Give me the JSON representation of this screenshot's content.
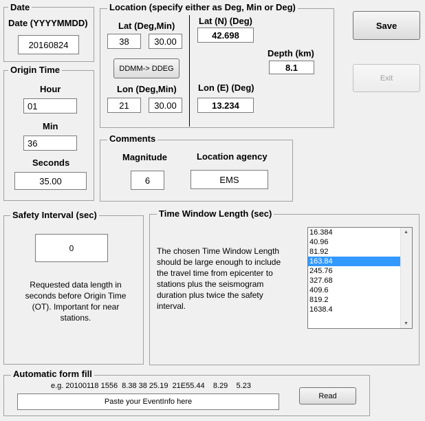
{
  "date_group": {
    "legend": "Date",
    "label": "Date  (YYYYMMDD)",
    "value": "20160824"
  },
  "origin_time": {
    "legend": "Origin Time",
    "hour_label": "Hour",
    "hour_value": "01",
    "min_label": "Min",
    "min_value": "36",
    "seconds_label": "Seconds",
    "seconds_value": "35.00"
  },
  "location": {
    "legend": "Location (specify either as Deg, Min or Deg)",
    "lat_dm_label": "Lat (Deg,Min)",
    "lat_deg": "38",
    "lat_min": "30.00",
    "convert_button": "DDMM-> DDEG",
    "lon_dm_label": "Lon (Deg,Min)",
    "lon_deg": "21",
    "lon_min": "30.00",
    "lat_n_label": "Lat (N)  (Deg)",
    "lat_n_value": "42.698",
    "depth_label": "Depth  (km)",
    "depth_value": "8.1",
    "lon_e_label": "Lon (E) (Deg)",
    "lon_e_value": "13.234"
  },
  "comments": {
    "legend": "Comments",
    "magnitude_label": "Magnitude",
    "magnitude_value": "6",
    "agency_label": "Location agency",
    "agency_value": "EMS"
  },
  "buttons": {
    "save": "Save",
    "exit": "Exit",
    "read": "Read"
  },
  "safety": {
    "legend": "Safety Interval (sec)",
    "value": "0",
    "description": "Requested data length in seconds before Origin Time (OT). Important for near stations."
  },
  "time_window": {
    "legend": "Time Window Length (sec)",
    "description": "The chosen Time Window Length should be large enough to include the travel time from epicenter to stations plus the seismogram duration plus twice the safety interval.",
    "options": [
      "16.384",
      "40.96",
      "81.92",
      "163.84",
      "245.76",
      "327.68",
      "409.6",
      "819.2",
      "1638.4"
    ],
    "selected": "163.84"
  },
  "auto_fill": {
    "legend": "Automatic form fill",
    "example": "e.g. 20100118 1556  8.38 38 25.19  21E55.44    8.29    5.23",
    "placeholder": "Paste your EventInfo here"
  },
  "icons": {
    "scroll_up": "chevron-up-icon",
    "scroll_down": "chevron-down-icon"
  }
}
